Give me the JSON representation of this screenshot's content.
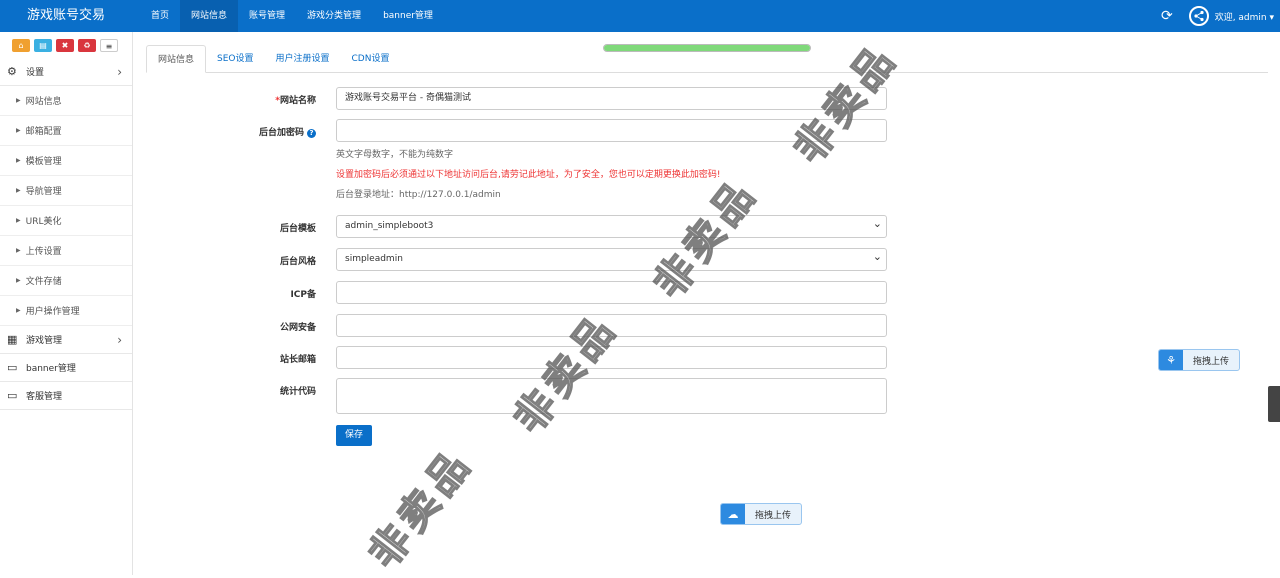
{
  "brand": "游戏账号交易",
  "nav": [
    "首页",
    "网站信息",
    "账号管理",
    "游戏分类管理",
    "banner管理"
  ],
  "welcome": "欢迎, admin",
  "sidebar": {
    "settings": "设置",
    "items": [
      "网站信息",
      "邮箱配置",
      "模板管理",
      "导航管理",
      "URL美化",
      "上传设置",
      "文件存储",
      "用户操作管理"
    ],
    "game_manage": "游戏管理",
    "banner_manage": "banner管理",
    "service_manage": "客服管理"
  },
  "tabs": [
    "网站信息",
    "SEO设置",
    "用户注册设置",
    "CDN设置"
  ],
  "progress": 1.0,
  "form": {
    "site_name_label": "网站名称",
    "site_name_value": "游戏账号交易平台 - 奇偶猫测试",
    "admin_code_label": "后台加密码",
    "admin_code_hint": "英文字母数字，不能为纯数字",
    "admin_code_warn": "设置加密码后必须通过以下地址访问后台,请劳记此地址，为了安全，您也可以定期更换此加密码!",
    "admin_url": "后台登录地址：http://127.0.0.1/admin",
    "template_label": "后台模板",
    "template_value": "admin_simpleboot3",
    "style_label": "后台风格",
    "style_value": "simpleadmin",
    "icp_label": "ICP备",
    "police_label": "公网安备",
    "email_label": "站长邮箱",
    "stats_label": "统计代码",
    "save": "保存"
  },
  "upload_button": "拖拽上传",
  "upload_button2": "拖拽上传",
  "watermark": "非卖品",
  "colors": {
    "primary": "#0a6fc9",
    "warn": "#e33333",
    "progress": "#7fd97a"
  }
}
